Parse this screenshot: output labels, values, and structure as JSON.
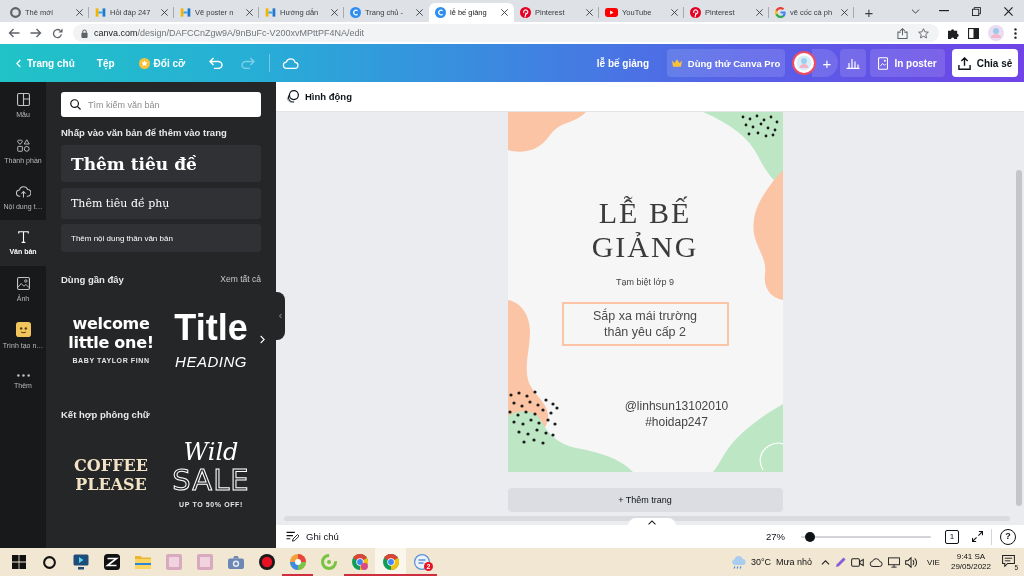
{
  "browser": {
    "tabs": [
      {
        "kind": "newtab",
        "title": "Thẻ mới",
        "selected": false
      },
      {
        "kind": "hoidap",
        "title": "Hỏi đáp 247",
        "selected": false
      },
      {
        "kind": "hoidap",
        "title": "Vẽ poster n",
        "selected": false
      },
      {
        "kind": "hoidap",
        "title": "Hướng dẫn",
        "selected": false
      },
      {
        "kind": "canva",
        "title": "Trang chủ -",
        "selected": false
      },
      {
        "kind": "canva",
        "title": "lễ bế giảng",
        "selected": true
      },
      {
        "kind": "pinterest",
        "title": "Pinterest",
        "selected": false
      },
      {
        "kind": "youtube",
        "title": "YouTube",
        "selected": false
      },
      {
        "kind": "pinterest",
        "title": "Pinterest",
        "selected": false
      },
      {
        "kind": "google",
        "title": "vẽ cốc cà ph",
        "selected": false
      }
    ],
    "new_tab": "+",
    "url": "canva.com/design/DAFCCnZgw9A/9nBuFc-V200xvMPttPF4NA/edit"
  },
  "canva_bar": {
    "home": "Trang chủ",
    "file": "Tệp",
    "resize": "Đổi cỡ",
    "undo": {
      "disabled": false
    },
    "redo": {
      "disabled": true
    },
    "design_title": "lễ bế giảng",
    "pro_trial": "Dùng thử Canva Pro",
    "invite": "+",
    "print": "In poster",
    "share": "Chia sẻ"
  },
  "rail": [
    {
      "kind": "templates",
      "label": "Mẫu",
      "selected": false
    },
    {
      "kind": "elements",
      "label": "Thành phần",
      "selected": false
    },
    {
      "kind": "uploads",
      "label": "Nội dung t…",
      "selected": false
    },
    {
      "kind": "text",
      "label": "Văn bản",
      "selected": true
    },
    {
      "kind": "photos",
      "label": "Ảnh",
      "selected": false
    },
    {
      "kind": "apps",
      "label": "Trình tạo n…",
      "selected": false
    },
    {
      "kind": "more",
      "label": "Thêm",
      "selected": false
    }
  ],
  "panel": {
    "search": {
      "placeholder": "Tìm kiếm văn bản"
    },
    "hint": "Nhấp vào văn bản để thêm vào trang",
    "presets": [
      {
        "kind": "heading",
        "label": "Thêm tiêu đề"
      },
      {
        "kind": "subheading",
        "label": "Thêm tiêu đề phụ"
      },
      {
        "kind": "body",
        "label": "Thêm nội dung thân văn bản"
      }
    ],
    "sections": [
      {
        "title": "Dùng gần đây",
        "see_all": "Xem tất cả",
        "items": [
          {
            "lines": [
              {
                "kind": "rounded",
                "text": "welcome"
              },
              {
                "kind": "rounded",
                "text": "little one!"
              },
              {
                "kind": "caption",
                "text": "BABY TAYLOR FINN"
              }
            ]
          },
          {
            "lines": [
              {
                "kind": "large",
                "text": "Title"
              },
              {
                "kind": "italic",
                "text": "HEADING"
              }
            ]
          }
        ]
      },
      {
        "title": "Kết hợp phông chữ",
        "items": [
          {
            "lines": [
              {
                "kind": "slab",
                "text": "COFFEE"
              },
              {
                "kind": "slab",
                "text": "PLEASE"
              }
            ]
          },
          {
            "lines": [
              {
                "kind": "script",
                "text": "Wild"
              },
              {
                "kind": "outline",
                "text": "SALE"
              },
              {
                "kind": "caption",
                "text": "UP TO 50% OFF!"
              }
            ]
          }
        ]
      }
    ]
  },
  "editor": {
    "animate": "Hình động",
    "poster": {
      "title": "LỄ BẾ GIẢNG",
      "subtitle": "Tạm biệt lớp 9",
      "message": "Sắp xa mái trường thân yêu cấp 2",
      "credits": "@linhsun13102010 #hoidap247"
    },
    "add_page": "+ Thêm trang"
  },
  "footer": {
    "notes": "Ghi chú",
    "zoom": "27%",
    "zoom_slider": {
      "level": 0.03
    },
    "page_count": "1",
    "help": "?"
  },
  "taskbar": {
    "apps": [
      {
        "kind": "start",
        "running": false,
        "selected": false
      },
      {
        "kind": "search",
        "running": false,
        "selected": false
      },
      {
        "kind": "monitor",
        "running": false,
        "selected": false
      },
      {
        "kind": "capcut",
        "running": false,
        "selected": false
      },
      {
        "kind": "folder",
        "running": false,
        "selected": false
      },
      {
        "kind": "photo",
        "running": false,
        "selected": false
      },
      {
        "kind": "photo",
        "running": false,
        "selected": false
      },
      {
        "kind": "camera",
        "running": false,
        "selected": false
      },
      {
        "kind": "record",
        "running": false,
        "selected": false
      },
      {
        "kind": "colorwheel",
        "running": true,
        "selected": false
      },
      {
        "kind": "spiral",
        "running": false,
        "selected": false
      },
      {
        "kind": "chrome-profile",
        "running": true,
        "selected": false
      },
      {
        "kind": "chrome",
        "running": true,
        "selected": true
      },
      {
        "kind": "chat",
        "running": true,
        "selected": false,
        "badge": "2"
      }
    ],
    "weather": {
      "temperature": "30°C",
      "condition": "Mưa nhỏ"
    },
    "language": "VIE",
    "time": "9:41 SA",
    "date": "29/05/2022",
    "notifications": "5"
  }
}
